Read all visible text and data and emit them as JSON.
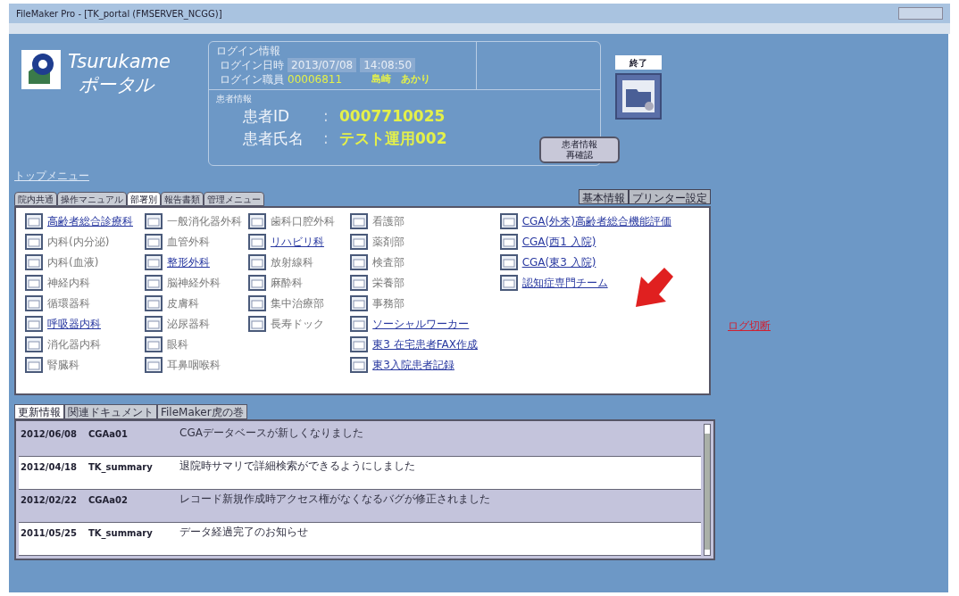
{
  "window": {
    "title": "FileMaker Pro - [TK_portal (FMSERVER_NCGG)]"
  },
  "logo": {
    "name": "Tsurukame",
    "subtitle": "ポータル"
  },
  "login_info": {
    "heading": "ログイン情報",
    "date_label": "ログイン日時",
    "date": "2013/07/08",
    "time": "14:08:50",
    "staff_label": "ログイン職員",
    "staff_id": "00006811",
    "staff_name": "島崎　あかり"
  },
  "patient_info": {
    "heading": "患者情報",
    "id_label": "患者ID",
    "id": "0007710025",
    "name_label": "患者氏名",
    "name": "テスト運用002",
    "separator": ":",
    "recheck_button": [
      "患者情報",
      "再確認"
    ]
  },
  "exit_button": "終了",
  "top_menu_link": "トップメニュー",
  "menu_tabs": [
    {
      "label": "院内共通",
      "selected": false
    },
    {
      "label": "操作マニュアル",
      "selected": false
    },
    {
      "label": "部署別",
      "selected": true
    },
    {
      "label": "報告書類",
      "selected": false
    },
    {
      "label": "管理メニュー",
      "selected": false
    }
  ],
  "setting_buttons": [
    "基本情報",
    "プリンター設定"
  ],
  "departments": [
    [
      {
        "label": "高齢者総合診療科",
        "link": true
      },
      {
        "label": "内科(内分泌)",
        "link": false
      },
      {
        "label": "内科(血液)",
        "link": false
      },
      {
        "label": "神経内科",
        "link": false
      },
      {
        "label": "循環器科",
        "link": false
      },
      {
        "label": "呼吸器内科",
        "link": true
      },
      {
        "label": "消化器内科",
        "link": false
      },
      {
        "label": "腎臓科",
        "link": false
      }
    ],
    [
      {
        "label": "一般消化器外科",
        "link": false
      },
      {
        "label": "血管外科",
        "link": false
      },
      {
        "label": "整形外科",
        "link": true
      },
      {
        "label": "脳神経外科",
        "link": false
      },
      {
        "label": "皮膚科",
        "link": false
      },
      {
        "label": "泌尿器科",
        "link": false
      },
      {
        "label": "眼科",
        "link": false
      },
      {
        "label": "耳鼻咽喉科",
        "link": false
      }
    ],
    [
      {
        "label": "歯科口腔外科",
        "link": false
      },
      {
        "label": "リハビリ科",
        "link": true
      },
      {
        "label": "放射線科",
        "link": false
      },
      {
        "label": "麻酔科",
        "link": false
      },
      {
        "label": "集中治療部",
        "link": false
      },
      {
        "label": "長寿ドック",
        "link": false
      }
    ],
    [
      {
        "label": "看護部",
        "link": false
      },
      {
        "label": "薬剤部",
        "link": false
      },
      {
        "label": "検査部",
        "link": false
      },
      {
        "label": "栄養部",
        "link": false
      },
      {
        "label": "事務部",
        "link": false
      },
      {
        "label": "ソーシャルワーカー",
        "link": true
      },
      {
        "label": "東3 在宅患者FAX作成",
        "link": true
      },
      {
        "label": "東3入院患者記録",
        "link": true
      }
    ],
    [
      {
        "label": "CGA(外来)",
        "note": "高齢者総合機能評価",
        "link": true
      },
      {
        "label": "CGA(西1 入院)",
        "link": true
      },
      {
        "label": "CGA(東3 入院)",
        "link": true
      },
      {
        "label": "認知症専門チーム",
        "link": true
      }
    ]
  ],
  "red_link": "ログ切断",
  "news_tabs": [
    {
      "label": "更新情報",
      "selected": true
    },
    {
      "label": "関連ドキュメント",
      "selected": false
    },
    {
      "label": "FileMaker虎の巻",
      "selected": false
    }
  ],
  "news": [
    {
      "date": "2012/06/08",
      "db": "CGAa01",
      "text": "CGAデータベースが新しくなりました"
    },
    {
      "date": "2012/04/18",
      "db": "TK_summary",
      "text": "退院時サマリで詳細検索ができるようにしました"
    },
    {
      "date": "2012/02/22",
      "db": "CGAa02",
      "text": "レコード新規作成時アクセス権がなくなるバグが修正されました"
    },
    {
      "date": "2011/05/25",
      "db": "TK_summary",
      "text": "データ経過完了のお知らせ"
    }
  ]
}
